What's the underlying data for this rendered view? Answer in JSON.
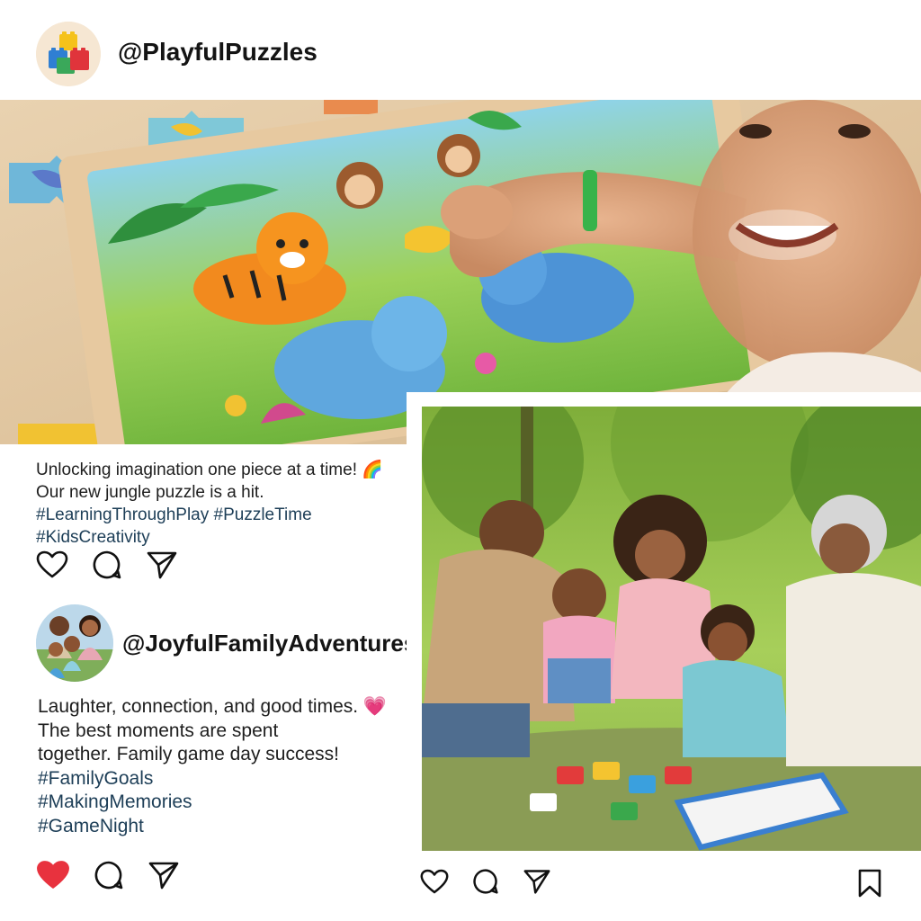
{
  "post1": {
    "handle": "@PlayfulPuzzles",
    "avatar_icon": "toy-blocks-icon",
    "photo_alt": "jungle-puzzle-photo",
    "caption_text": "Unlocking imagination one piece at a time! 🌈 Our new jungle puzzle is a hit.",
    "hashtags": "#LearningThroughPlay #PuzzleTime #KidsCreativity",
    "liked": false
  },
  "post2": {
    "handle": "@JoyfulFamilyAdventures",
    "avatar_icon": "family-photo-avatar",
    "caption_line1": "Laughter, connection, and good times. 💗",
    "caption_line2": "The best moments are spent",
    "caption_line3": "together. Family game day success!",
    "tag1": "#FamilyGoals",
    "tag2": "#MakingMemories",
    "tag3": "#GameNight",
    "liked": true
  },
  "icons": {
    "like": "heart-icon",
    "comment": "comment-icon",
    "share": "send-icon",
    "save": "bookmark-icon"
  },
  "colors": {
    "like_active": "#e8323e",
    "hashtag": "#1d3e57",
    "text": "#1e1e1e"
  }
}
